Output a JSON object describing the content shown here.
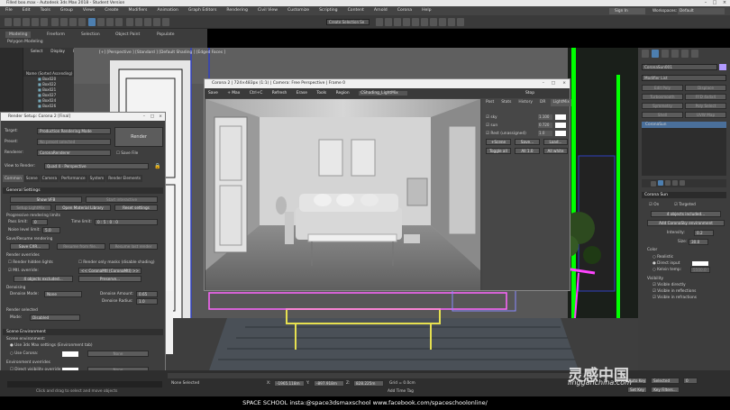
{
  "app": {
    "title": "Filled boo.max - Autodesk 3ds Max 2018 - Student Version",
    "sign_in": "Sign In",
    "workspaces_label": "Workspaces:",
    "workspaces_value": "Default"
  },
  "menu": [
    "File",
    "Edit",
    "Tools",
    "Group",
    "Views",
    "Create",
    "Modifiers",
    "Animation",
    "Graph Editors",
    "Rendering",
    "Civil View",
    "Customize",
    "Scripting",
    "Content",
    "Arnold",
    "Corona",
    "Help"
  ],
  "toolbar": {
    "selection_set": "Create Selection Se"
  },
  "ribbon": {
    "tabs": [
      "Modeling",
      "Freeform",
      "Selection",
      "Object Paint",
      "Populate"
    ],
    "sub": "Polygon Modeling"
  },
  "explorer": {
    "tabs": [
      "Select",
      "Display",
      "Edit"
    ],
    "header": "Name (Sorted Ascending)",
    "items": [
      "Box020",
      "Box022",
      "Box021",
      "Box027",
      "Box024",
      "Box026"
    ]
  },
  "viewport": {
    "label": "[+] [Perspective ] [Standard ] [Default Shading ] [Edged Faces ]"
  },
  "render_setup": {
    "title": "Render Setup: Corona 2 [Final]",
    "target_label": "Target:",
    "target_value": "Production Rendering Mode",
    "preset_label": "Preset:",
    "preset_value": "No preset selected",
    "renderer_label": "Renderer:",
    "renderer_value": "CoronaRenderer",
    "save_file": "Save File",
    "render_btn": "Render",
    "view_label": "View to Render:",
    "view_value": "Quad 4 - Perspective",
    "tabs": [
      "Common",
      "Scene",
      "Camera",
      "Performance",
      "System",
      "Render Elements"
    ],
    "general_settings": "General Settings",
    "show_vfb": "Show VFB",
    "interactive": "Start interactive",
    "setup_lightmix": "Setup LightMix",
    "open_mat_lib": "Open Material Library",
    "reset_settings": "Reset settings",
    "progressive_limits": "Progressive rendering limits",
    "pass_limit_label": "Pass limit:",
    "pass_limit": "0",
    "time_limit_label": "Time limit:",
    "time_limit": "0 : 5 : 0 : 0",
    "noise_label": "Noise level limit:",
    "noise_value": "5.0",
    "save_resume": "Save/Resume rendering",
    "save_cxr": "Save CXR...",
    "resume_file": "Resume from file...",
    "resume_last": "Resume last render",
    "render_overrides": "Render overrides",
    "render_hidden": "Render hidden lights",
    "render_masks": "Render only masks (disable shading)",
    "mtl_override": "Mtl. override:",
    "mtl_value": "<< CoronaMtl (CoronaMtl) >>",
    "excluded": "4 objects excluded...",
    "preserve": "Preserve...",
    "denoising": "Denoising",
    "denoise_mode_label": "Denoise Mode:",
    "denoise_mode": "None",
    "denoise_amount_label": "Denoise Amount:",
    "denoise_amount": "0.65",
    "denoise_radius_label": "Denoise Radius:",
    "denoise_radius": "1.0",
    "render_selected": "Render selected",
    "mode_label": "Mode:",
    "mode_value": "Disabled",
    "scene_env": "Scene Environment",
    "scene_env_sub": "Scene environment:",
    "use_3ds": "Use 3ds Max settings (Environment tab)",
    "use_corona": "Use Corona:",
    "env_overrides": "Environment overrides",
    "direct_vis": "Direct visibility override:",
    "reflections": "Reflections override:",
    "refractions": "Refractions override:",
    "none": "None"
  },
  "vfb": {
    "title": "Corona 2 | 724×483px (1:1) | Camera: Free Perspective | Frame 0",
    "toolbar": [
      "Save",
      "+ Max",
      "Ctrl+C",
      "Refresh",
      "Erase",
      "Tools",
      "Region",
      "CShading_LightMix",
      "Stop"
    ],
    "tabs": [
      "Post",
      "Stats",
      "History",
      "DR",
      "LightMix"
    ],
    "rows": [
      {
        "label": "sky",
        "value": "1.100"
      },
      {
        "label": "sun",
        "value": "0.720"
      },
      {
        "label": "Rest (unassigned)",
        "value": "1.0"
      }
    ],
    "buttons": [
      "+Scene",
      "Save...",
      "Load...",
      "Toggle all",
      "All 1.0",
      "All white"
    ]
  },
  "command_panel": {
    "object_name": "CoronaSun001",
    "modifier_list": "Modifier List",
    "buttons": [
      "Edit Poly",
      "Displace",
      "Turbosmooth",
      "FFD 4x4x4",
      "Symmetry",
      "Poly Select",
      "Shell",
      "UVW Map"
    ],
    "stack_item": "CoronaSun",
    "rollout": "Corona Sun",
    "on": "On",
    "targeted": "Targeted",
    "objects_included": "4 objects included...",
    "add_env": "Add CoronaSky environment",
    "intensity_label": "Intensity:",
    "intensity": "0.2",
    "size_label": "Size:",
    "size": "30.0",
    "color": "Color",
    "realistic": "Realistic",
    "direct_input": "Direct input",
    "kelvin": "Kelvin temp:",
    "kelvin_value": "5500.0",
    "visibility": "Visibility",
    "visible_directly": "Visible directly",
    "visible_reflections": "Visible in reflections",
    "visible_refractions": "Visible in refractions"
  },
  "status": {
    "selection_text": "None Selected",
    "hint": "Click and drag to select and move objects",
    "x": "-1965.118m",
    "y": "-897.918m",
    "z": "828.225m",
    "grid": "Grid = 0.0cm",
    "add_time_tag": "Add Time Tag",
    "auto_key": "Auto Key",
    "selected": "Selected",
    "set_key": "Set Key",
    "key_filters": "Key Filters...",
    "frame": "0"
  },
  "footer": {
    "text": "SPACE SCHOOL   insta:@space3dsmaxschool   www.facebook.com/spaceschoolonline/"
  },
  "watermark": {
    "cn": "灵感中国",
    "site": "lingganchina.com"
  },
  "colors": {
    "accent": "#4d9be6",
    "selection_green": "#00ff00",
    "panel": "#3d3d3d"
  }
}
